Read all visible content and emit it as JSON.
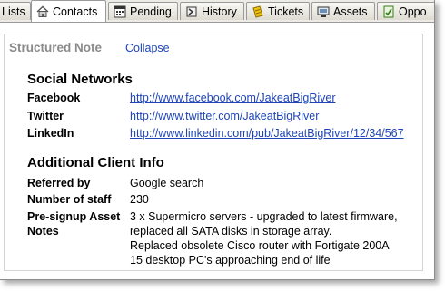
{
  "tabs": [
    {
      "label": "Lists",
      "icon": "list-icon"
    },
    {
      "label": "Contacts",
      "icon": "home-icon",
      "active": true
    },
    {
      "label": "Pending",
      "icon": "pending-icon"
    },
    {
      "label": "History",
      "icon": "history-icon"
    },
    {
      "label": "Tickets",
      "icon": "ticket-icon"
    },
    {
      "label": "Assets",
      "icon": "assets-icon"
    },
    {
      "label": "Oppo",
      "icon": "opportunity-icon"
    }
  ],
  "note": {
    "title": "Structured Note",
    "collapse_label": "Collapse"
  },
  "social": {
    "heading": "Social Networks",
    "rows": [
      {
        "label": "Facebook",
        "value": "http://www.facebook.com/JakeatBigRiver"
      },
      {
        "label": "Twitter",
        "value": "http://www.twitter.com/JakeatBigRiver"
      },
      {
        "label": "LinkedIn",
        "value": "http://www.linkedin.com/pub/JakeatBigRiver/12/34/567"
      }
    ]
  },
  "client": {
    "heading": "Additional Client Info",
    "rows": [
      {
        "label": "Referred by",
        "value": "Google search"
      },
      {
        "label": "Number of staff",
        "value": "230"
      },
      {
        "label": "Pre-signup Asset Notes",
        "lines": [
          "3 x Supermicro servers - upgraded to latest firmware,",
          "replaced all SATA disks in storage array.",
          "Replaced obsolete Cisco router with Fortigate 200A",
          "15 desktop PC's approaching end of life"
        ]
      }
    ]
  },
  "colors": {
    "link": "#1f45b8",
    "muted_title": "#8a8a8a",
    "tabbar_bg": "#ecebe5"
  }
}
